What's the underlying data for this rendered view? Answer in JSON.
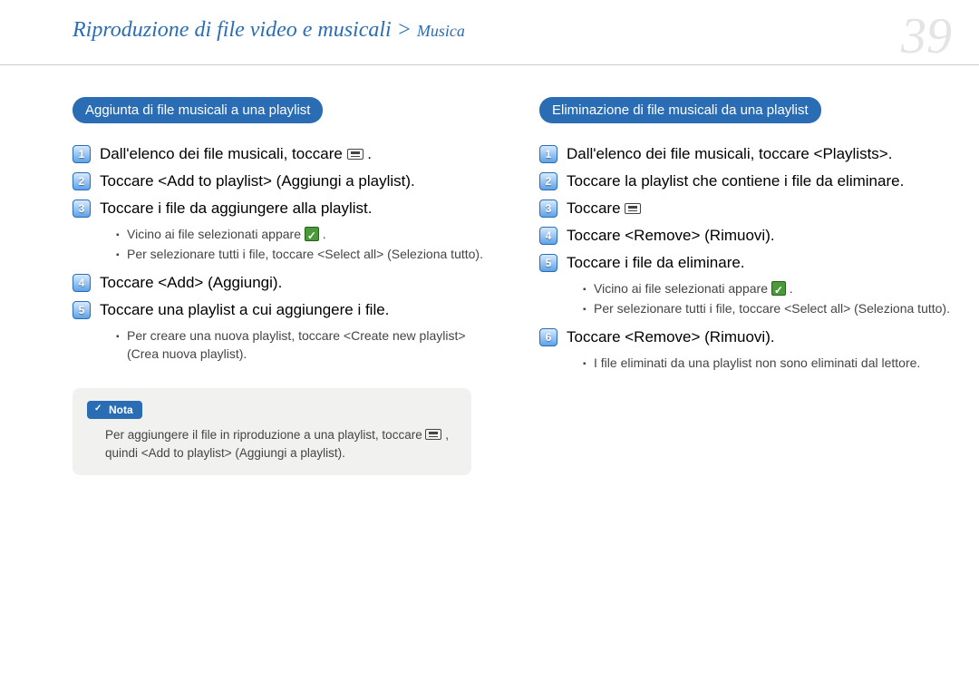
{
  "header": {
    "breadcrumb_main": "Riproduzione di file video e musicali > ",
    "breadcrumb_sub": "Musica",
    "page_number": "39"
  },
  "left": {
    "section_title": "Aggiunta di file musicali a una playlist",
    "steps": [
      {
        "n": "1",
        "text_pre": "Dall'elenco dei file musicali, toccare ",
        "icon": "menu",
        "text_post": "."
      },
      {
        "n": "2",
        "text": "Toccare <Add to playlist> (Aggiungi a playlist)."
      },
      {
        "n": "3",
        "text": "Toccare i file da aggiungere alla playlist."
      },
      {
        "n": "4",
        "text": "Toccare <Add> (Aggiungi)."
      },
      {
        "n": "5",
        "text": "Toccare una playlist a cui aggiungere i file."
      }
    ],
    "sub_after_3": [
      {
        "pre": "Vicino ai file selezionati appare ",
        "icon": "check",
        "post": "."
      },
      {
        "text": "Per selezionare tutti i file, toccare <Select all> (Seleziona tutto)."
      }
    ],
    "sub_after_5": [
      {
        "text": "Per creare una nuova playlist, toccare <Create new playlist> (Crea nuova playlist)."
      }
    ],
    "note": {
      "label": "Nota",
      "text_pre": "Per aggiungere il file in riproduzione a una playlist, toccare ",
      "text_post": ", quindi <Add to playlist> (Aggiungi a playlist)."
    }
  },
  "right": {
    "section_title": "Eliminazione di file musicali da una playlist",
    "steps": [
      {
        "n": "1",
        "text": "Dall'elenco dei file musicali, toccare <Playlists>."
      },
      {
        "n": "2",
        "text": "Toccare la playlist che contiene i file da eliminare."
      },
      {
        "n": "3",
        "text_pre": "Toccare ",
        "icon": "menu",
        "text_post": ""
      },
      {
        "n": "4",
        "text": "Toccare <Remove> (Rimuovi)."
      },
      {
        "n": "5",
        "text": "Toccare i file da eliminare."
      },
      {
        "n": "6",
        "text": "Toccare <Remove> (Rimuovi)."
      }
    ],
    "sub_after_5": [
      {
        "pre": "Vicino ai file selezionati appare ",
        "icon": "check",
        "post": " ."
      },
      {
        "text": "Per selezionare tutti i file, toccare <Select all> (Seleziona tutto)."
      }
    ],
    "sub_after_6": [
      {
        "text": "I file eliminati da una playlist non sono eliminati dal lettore."
      }
    ]
  }
}
